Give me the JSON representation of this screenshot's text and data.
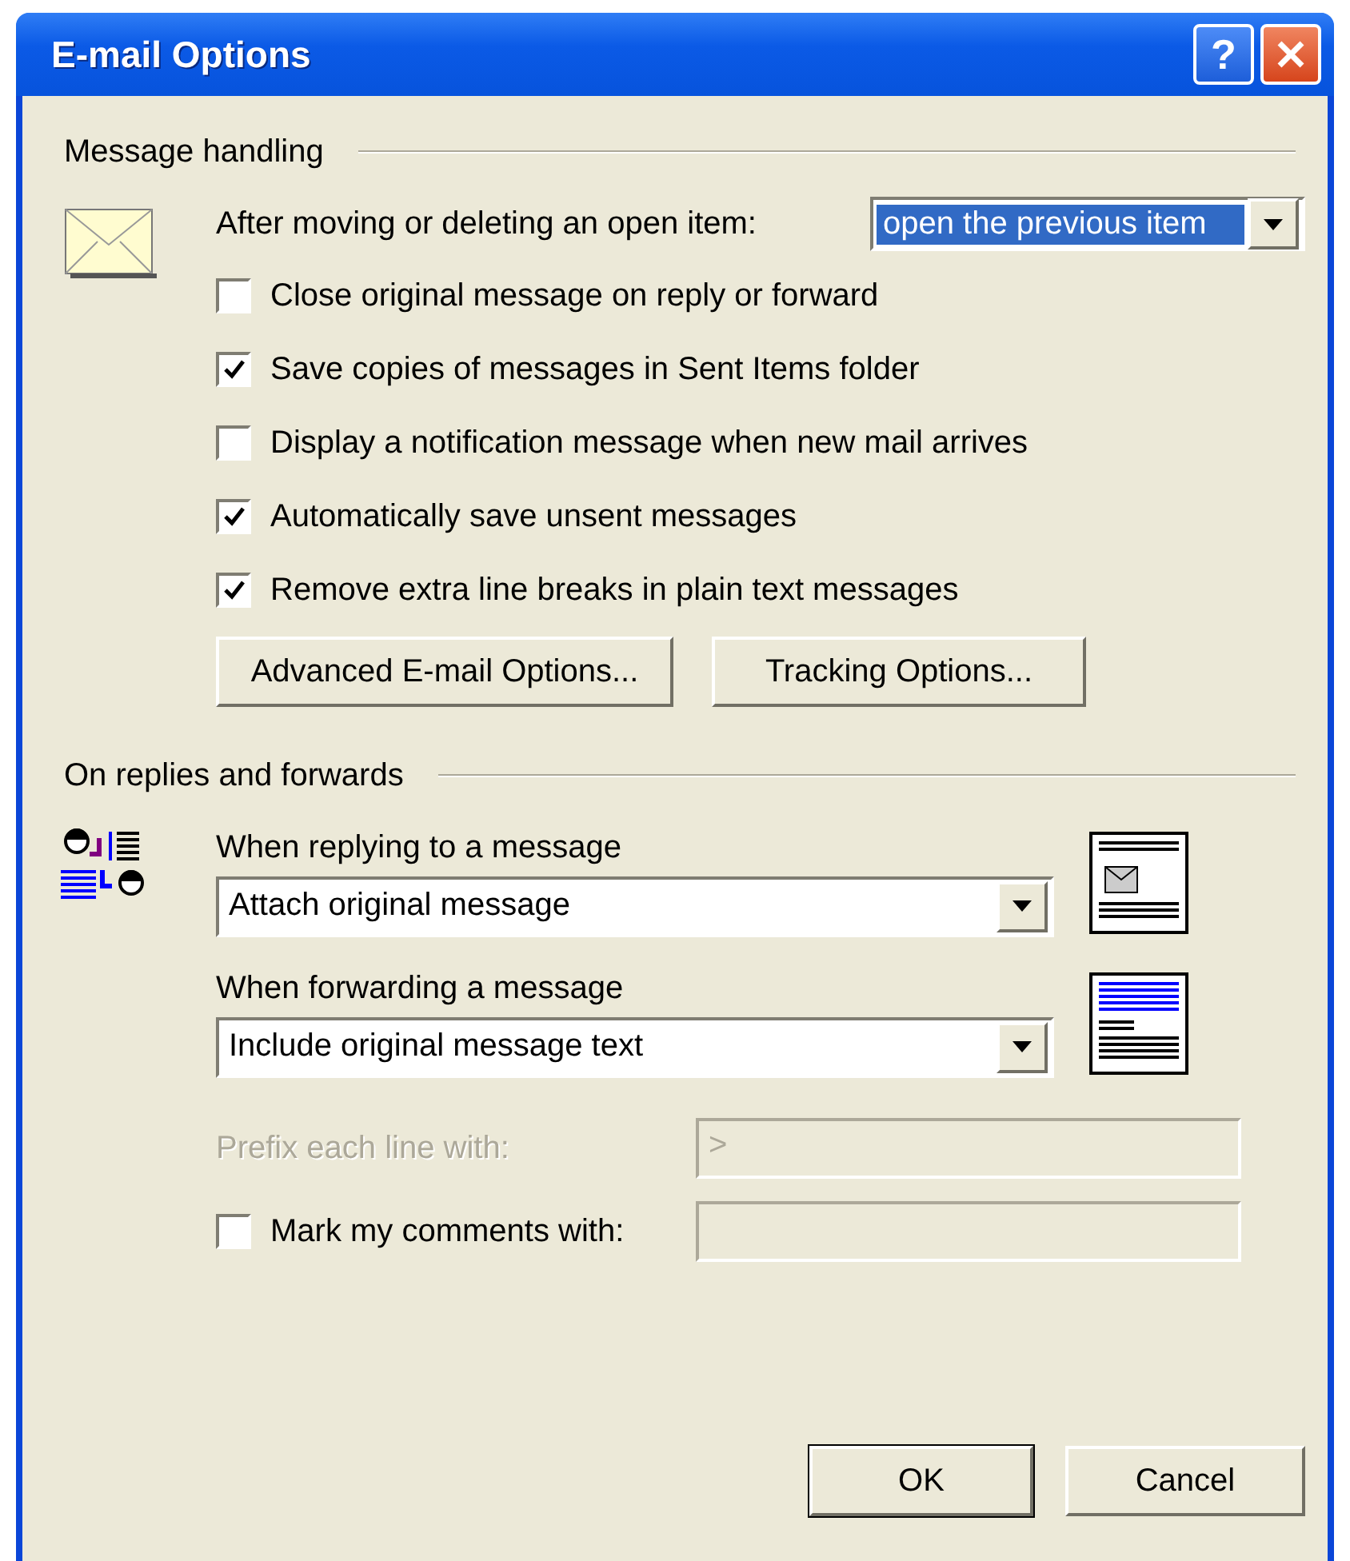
{
  "window": {
    "title": "E-mail Options",
    "help": "?"
  },
  "message_handling": {
    "heading": "Message handling",
    "after_move": {
      "label": "After moving or deleting an open item:",
      "value": "open the previous item",
      "focused": true
    },
    "options": [
      {
        "label": "Close original message on reply or forward",
        "checked": false
      },
      {
        "label": "Save copies of messages in Sent Items folder",
        "checked": true
      },
      {
        "label": "Display a notification message when new mail arrives",
        "checked": false
      },
      {
        "label": "Automatically save unsent messages",
        "checked": true
      },
      {
        "label": "Remove extra line breaks in plain text messages",
        "checked": true
      }
    ],
    "buttons": [
      {
        "label": "Advanced E-mail Options..."
      },
      {
        "label": "Tracking Options..."
      }
    ]
  },
  "replies_and_forwards": {
    "heading": "On replies and forwards",
    "replying": {
      "label": "When replying to a message",
      "value": "Attach original message",
      "kind": "attachment"
    },
    "forwarding": {
      "label": "When forwarding a message",
      "value": "Include original message text",
      "kind": "included"
    },
    "prefix": {
      "label": "Prefix each line with:",
      "value": ">",
      "disabled": true
    },
    "mark_comments": {
      "label": "Mark my comments with:",
      "checked": false,
      "disabled": true
    }
  },
  "buttons": [
    {
      "label": "OK",
      "default": true
    },
    {
      "label": "Cancel",
      "default": false
    }
  ]
}
